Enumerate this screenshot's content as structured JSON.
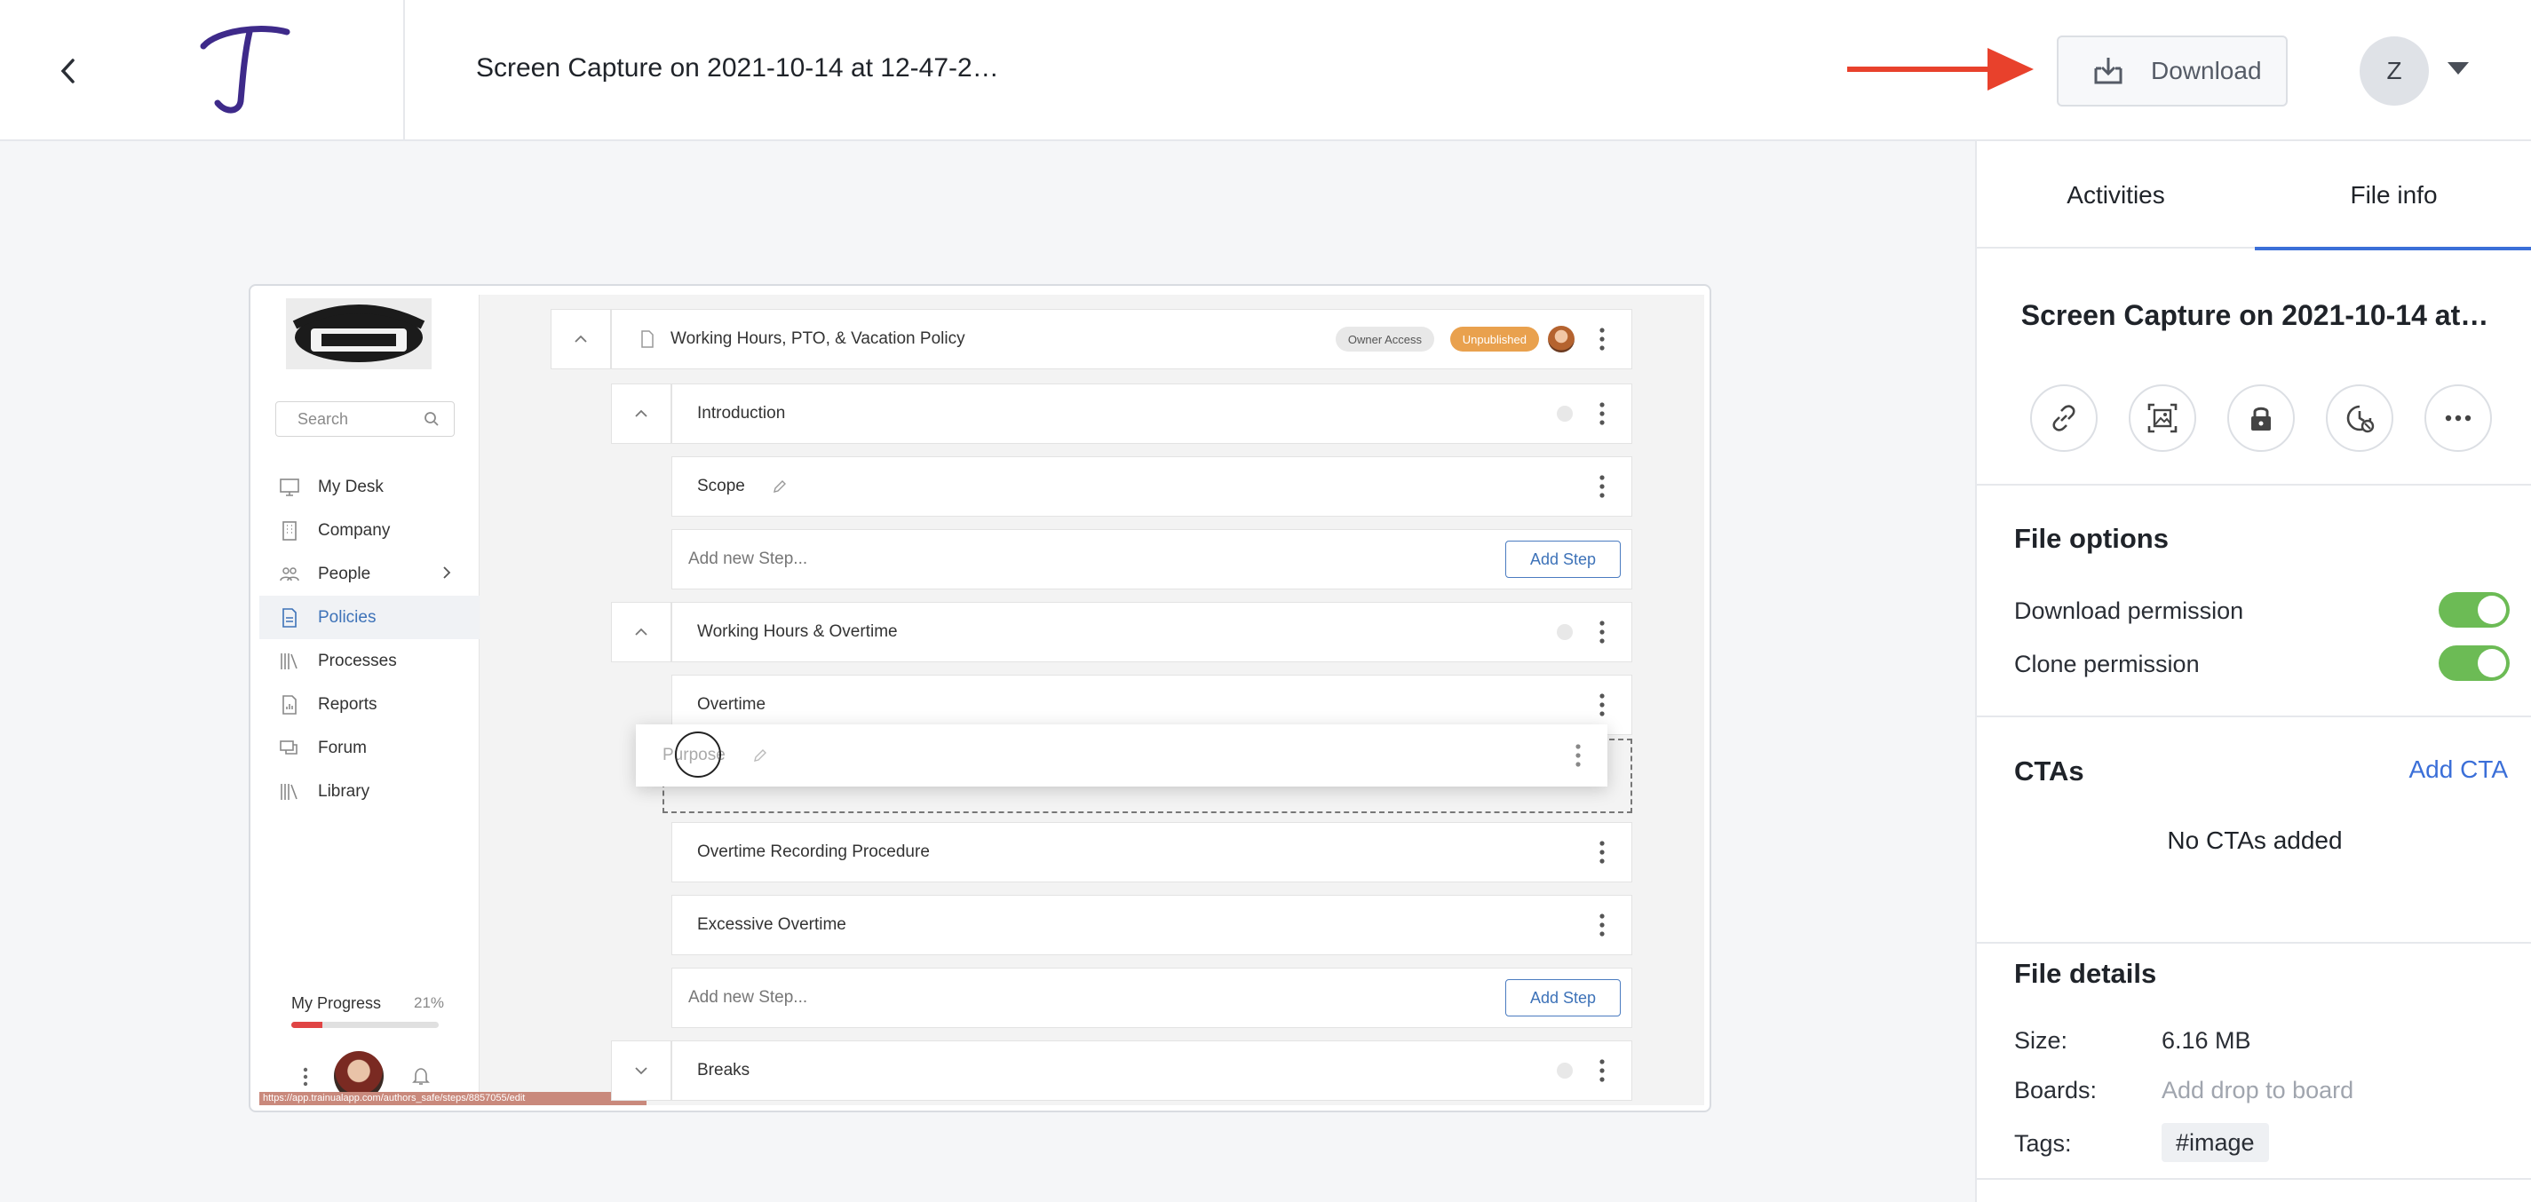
{
  "header": {
    "file_title": "Screen Capture on 2021-10-14 at 12-47-2…",
    "download_label": "Download",
    "avatar_initial": "Z"
  },
  "preview": {
    "sidebar": {
      "search_placeholder": "Search",
      "nav": [
        {
          "label": "My Desk",
          "icon": "monitor-icon"
        },
        {
          "label": "Company",
          "icon": "building-icon"
        },
        {
          "label": "People",
          "icon": "people-icon"
        },
        {
          "label": "Policies",
          "icon": "document-icon",
          "active": true
        },
        {
          "label": "Processes",
          "icon": "books-icon"
        },
        {
          "label": "Reports",
          "icon": "report-icon"
        },
        {
          "label": "Forum",
          "icon": "chat-icon"
        },
        {
          "label": "Library",
          "icon": "books-icon"
        }
      ],
      "progress_label": "My Progress",
      "progress_pct": "21%",
      "progress_value": 0.21,
      "url_text": "https://app.trainualapp.com/authors_safe/steps/8857055/edit"
    },
    "policy_title": "Working Hours, PTO, & Vacation Policy",
    "owner_badge": "Owner Access",
    "status_badge": "Unpublished",
    "sections": {
      "intro": "Introduction",
      "scope": "Scope",
      "add_step_placeholder_1": "Add new Step...",
      "add_step_label_1": "Add Step",
      "working_hours": "Working Hours & Overtime",
      "overtime": "Overtime",
      "dragging": "Purpose",
      "recording": "Overtime Recording Procedure",
      "excessive": "Excessive Overtime",
      "add_step_placeholder_2": "Add new Step...",
      "add_step_label_2": "Add Step",
      "breaks": "Breaks"
    }
  },
  "panel": {
    "tabs": {
      "activities": "Activities",
      "file_info": "File info"
    },
    "title": "Screen Capture on 2021-10-14 at…",
    "file_options_title": "File options",
    "download_permission": "Download permission",
    "clone_permission": "Clone permission",
    "ctas_title": "CTAs",
    "add_cta": "Add CTA",
    "no_ctas": "No CTAs added",
    "file_details_title": "File details",
    "size_label": "Size:",
    "size_value": "6.16 MB",
    "boards_label": "Boards:",
    "boards_placeholder": "Add drop to board",
    "tags_label": "Tags:",
    "tag": "#image"
  },
  "colors": {
    "accent": "#3b6fd8",
    "toggle_on": "#6cbb55",
    "arrow": "#e8412c",
    "unpublished": "#e9a14e"
  }
}
